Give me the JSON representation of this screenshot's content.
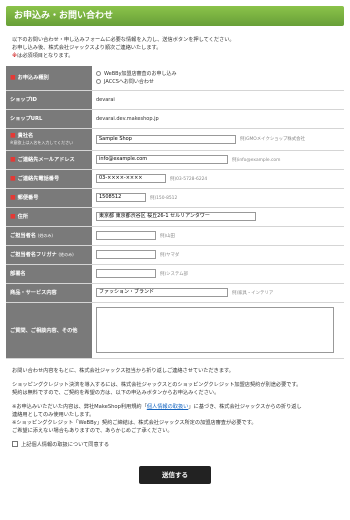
{
  "header": {
    "title": "お申込み・お問い合わせ"
  },
  "intro": {
    "line1": "以下のお問い合わせ・申し込みフォームに必要な情報を入力し、送信ボタンを押してください。",
    "line2": "お申し込み後、株式会社ジャックスより順次ご連絡いたします。",
    "req_mark": "※",
    "req_text": "は必須項目となります。"
  },
  "form": {
    "app_type": {
      "label": "お申込み種別",
      "options": [
        "WeBBy加盟店審査のお申し込み",
        "JACCSへお問い合わせ"
      ]
    },
    "shop_id": {
      "label": "ショップID",
      "value": "devarai"
    },
    "shop_url": {
      "label": "ショップURL",
      "value": "devarai.dev.makeshop.jp"
    },
    "company": {
      "label": "貴社名",
      "sub": "※意欲上は入名を入力してください",
      "value": "Sample Shop",
      "example": "例)GMOメイクショップ株式会社"
    },
    "email": {
      "label": "ご連絡先メールアドレス",
      "value": "info@example.com",
      "example": "例)info@example.com"
    },
    "phone": {
      "label": "ご連絡先電話番号",
      "value": "03-××××-××××",
      "example": "例)03-5728-6224"
    },
    "zip": {
      "label": "郵便番号",
      "value": "1508512",
      "example": "例)150-8512"
    },
    "address": {
      "label": "住所",
      "value": "東京都 東京都渋谷区 桜丘26-1 セルリアンタワー"
    },
    "name": {
      "label": "ご担当者名",
      "label_sub": "(姓のみ)",
      "value": "",
      "example": "例)山田"
    },
    "name_kana": {
      "label": "ご担当者名フリガナ",
      "label_sub": "(姓のみ)",
      "value": "",
      "example": "例)ヤマダ"
    },
    "dept": {
      "label": "部署名",
      "value": "",
      "example": "例)システム部"
    },
    "product": {
      "label": "商品・サービス内容",
      "value": "ファッション・ブランド",
      "example": "例)家具・インテリア"
    },
    "inquiry": {
      "label": "ご質問、ご相談内容、その他",
      "value": ""
    }
  },
  "notes": {
    "p1": "お問い合わせ内容をもとに、株式会社ジャックス担当から折り返しご連絡させていただきます。",
    "p2a": "ショッピングクレジット決済を導入するには、株式会社ジャックスとのショッピングクレジット加盟店契約が別途必要です。",
    "p2b": "契約は無料ですので、ご契約を希望の方は、以下の申込みボタンからお申込みください。",
    "p3a_pre": "※お申込みいただいた内容は、弊社MakeShop利用規約「",
    "p3a_link": "個人情報の取扱い",
    "p3a_post": "」に基づき、株式会社ジャックスからの折り返し",
    "p3b": "連絡用としてのみ使用いたします。",
    "p3c": "※ショッピングクレジット「WeBBy」契約ご締結は、株式会社ジャックス所定の加盟店審査が必要です。",
    "p3d": "ご希望に添えない場合もありますので、あらかじめご了承ください。",
    "agree_label": "上記個人情報の取扱について同意する"
  },
  "submit": {
    "label": "送信する"
  }
}
